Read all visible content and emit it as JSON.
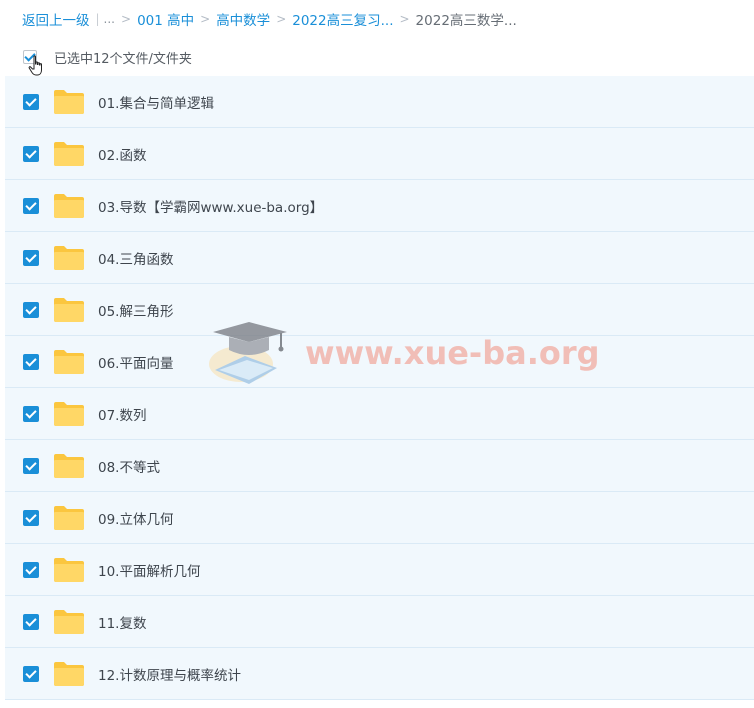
{
  "breadcrumb": {
    "back": "返回上一级",
    "ellipsis": "...",
    "separator": ">",
    "items": [
      "001 高中",
      "高中数学",
      "2022高三复习..."
    ],
    "current": "2022高三数学..."
  },
  "selection": {
    "text": "已选中12个文件/文件夹"
  },
  "files": [
    {
      "name": "01.集合与简单逻辑"
    },
    {
      "name": "02.函数"
    },
    {
      "name": "03.导数【学霸网www.xue-ba.org】"
    },
    {
      "name": "04.三角函数"
    },
    {
      "name": "05.解三角形"
    },
    {
      "name": "06.平面向量"
    },
    {
      "name": "07.数列"
    },
    {
      "name": "08.不等式"
    },
    {
      "name": "09.立体几何"
    },
    {
      "name": "10.平面解析几何"
    },
    {
      "name": "11.复数"
    },
    {
      "name": "12.计数原理与概率统计"
    }
  ],
  "watermark": {
    "text": "www.xue-ba.org"
  },
  "colors": {
    "accent": "#1a8fd8",
    "row_selected_bg": "#f1f8fd",
    "folder": "#ffd15c"
  }
}
